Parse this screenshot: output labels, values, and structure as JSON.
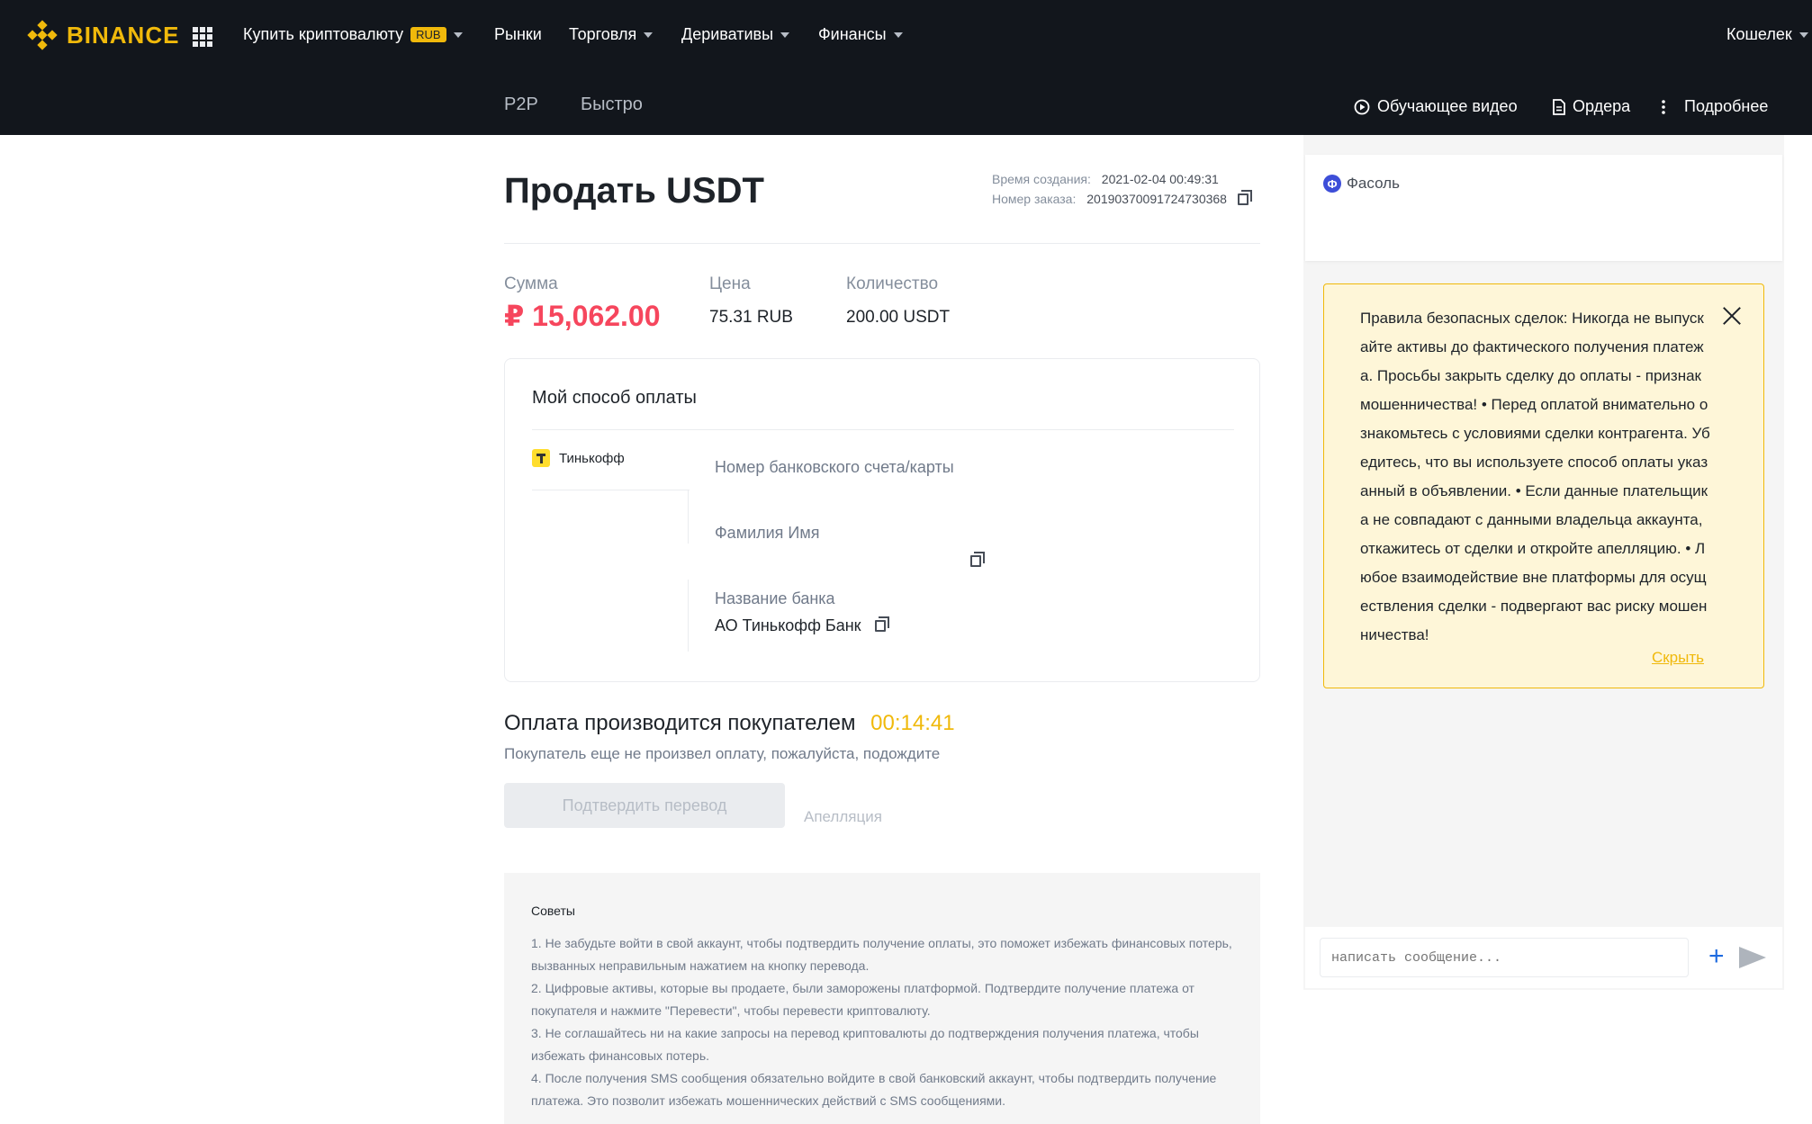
{
  "header": {
    "brand": "BINANCE",
    "nav": [
      {
        "label": "Купить криптовалюту",
        "badge": "RUB"
      },
      {
        "label": "Рынки"
      },
      {
        "label": "Торговля"
      },
      {
        "label": "Деривативы"
      },
      {
        "label": "Финансы"
      }
    ],
    "wallet": "Кошелек",
    "subnav": [
      "P2P",
      "Быстро"
    ],
    "right_links": [
      "Обучающее видео",
      "Ордера",
      "Подробнее"
    ]
  },
  "order": {
    "title": "Продать USDT",
    "created_label": "Время создания:",
    "created_value": "2021-02-04 00:49:31",
    "number_label": "Номер заказа:",
    "number_value": "20190370091724730368",
    "sum_label": "Сумма",
    "sum_value": "₽ 15,062.00",
    "price_label": "Цена",
    "price_value": "75.31 RUB",
    "qty_label": "Количество",
    "qty_value": "200.00 USDT"
  },
  "payment": {
    "title": "Мой способ оплаты",
    "method": "Тинькофф",
    "account_label": "Номер банковского счета/карты",
    "name_label": "Фамилия Имя",
    "bank_label": "Название банка",
    "bank_value": "АО Тинькофф Банк"
  },
  "status": {
    "title": "Оплата производится покупателем",
    "timer": "00:14:41",
    "subtitle": "Покупатель еще не произвел оплату, пожалуйста, подождите",
    "confirm_btn": "Подтвердить перевод",
    "appeal": "Апелляция"
  },
  "tips": {
    "title": "Советы",
    "items": [
      "1. Не забудьте войти в свой аккаунт, чтобы подтвердить получение оплаты, это поможет избежать финансовых потерь, вызванных неправильным нажатием на кнопку перевода.",
      "2. Цифровые активы, которые вы продаете, были заморожены платформой. Подтвердите получение платежа от покупателя и нажмите \"Перевести\", чтобы перевести криптовалюту.",
      "3. Не соглашайтесь ни на какие запросы на перевод криптовалюты до подтверждения получения платежа, чтобы избежать финансовых потерь.",
      "4. После получения SMS сообщения обязательно войдите в свой банковский аккаунт, чтобы подтвердить получение платежа. Это позволит избежать мошеннических действий с SMS сообщениями."
    ]
  },
  "chat": {
    "user_initial": "Ф",
    "user_name": "Фасоль",
    "warning": "Правила безопасных сделок: Никогда не выпускайте активы до фактического получения платежа. Просьбы закрыть сделку до оплаты - признак мошенничества! • Перед оплатой внимательно ознакомьтесь с условиями сделки контрагента. Убедитесь, что вы используете способ оплаты указанный в объявлении. • Если данные плательщика не совпадают с данными владельца аккаунта, откажитесь от сделки и откройте апелляцию. • Любое взаимодействие вне платформы для осуществления сделки - подвергают вас риску мошенничества!",
    "hide": "Скрыть",
    "input_placeholder": "написать сообщение..."
  },
  "colors": {
    "accent": "#f0b90b",
    "sell": "#f6465d",
    "nav_bg": "#12161c"
  }
}
